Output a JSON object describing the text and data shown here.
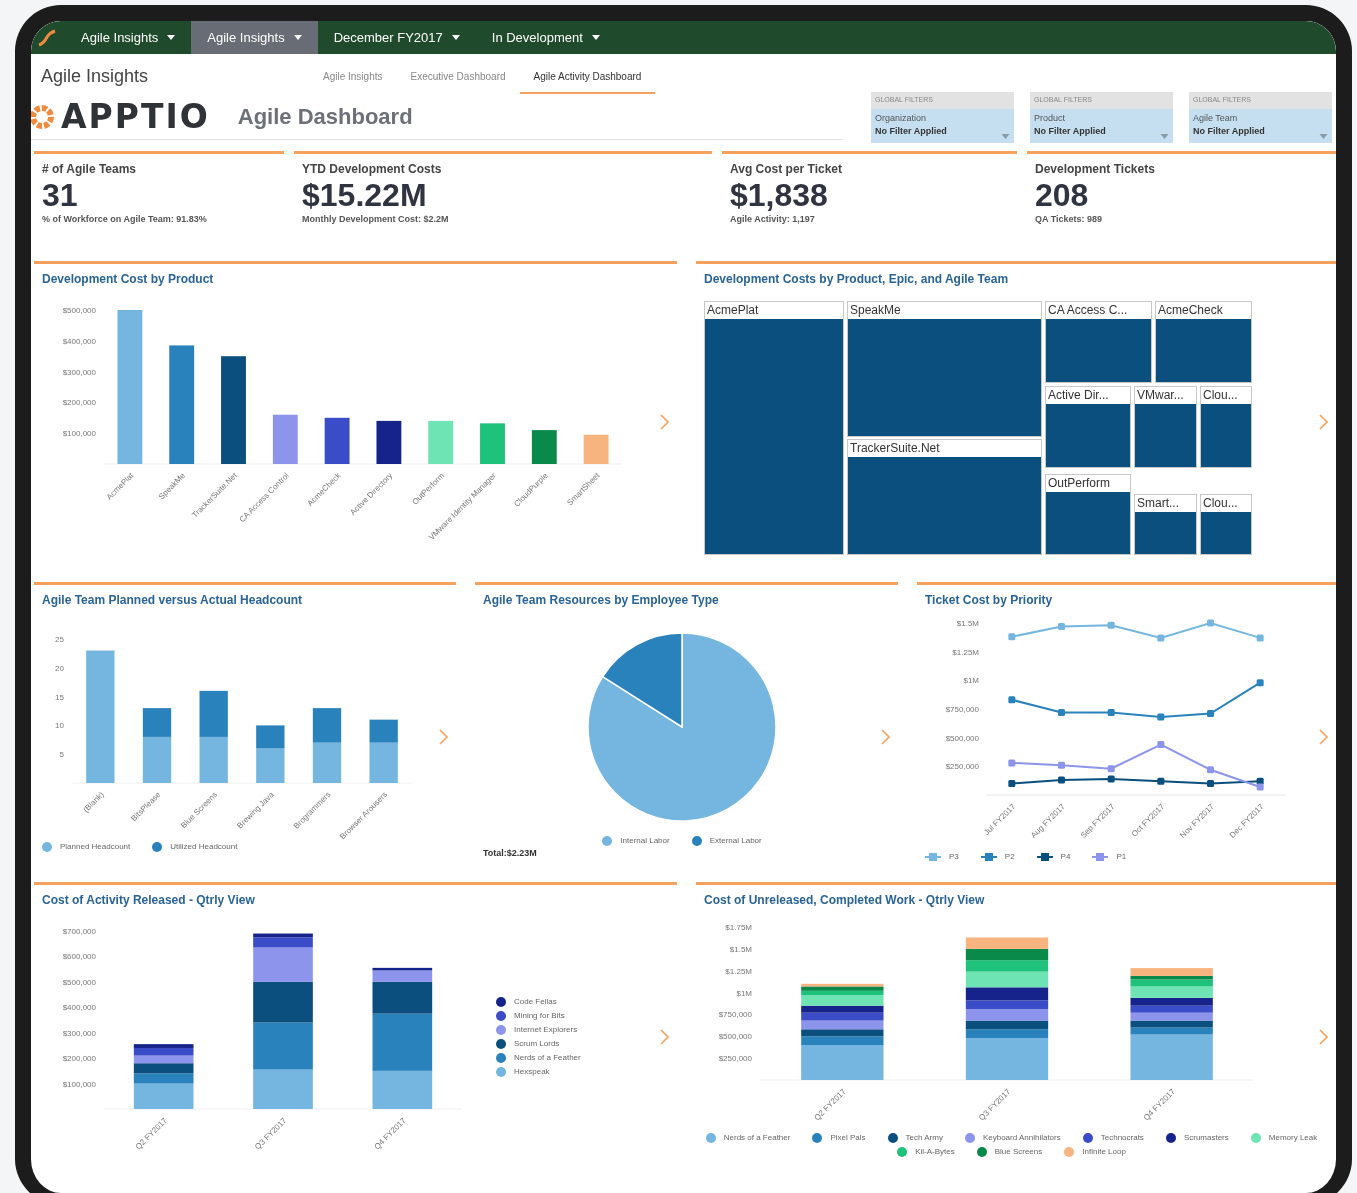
{
  "top_nav": [
    {
      "label": "Agile Insights",
      "selected": false
    },
    {
      "label": "Agile Insights",
      "selected": true
    },
    {
      "label": "December FY2017",
      "selected": false
    },
    {
      "label": "In Development",
      "selected": false
    }
  ],
  "header": {
    "app_title": "Agile Insights",
    "tabs": [
      {
        "label": "Agile Insights",
        "selected": false
      },
      {
        "label": "Executive Dashboard",
        "selected": false
      },
      {
        "label": "Agile Activity Dashboard",
        "selected": true
      }
    ],
    "brand": "APPTIO",
    "dashboard_title": "Agile Dashboard",
    "filters": [
      {
        "group": "GLOBAL FILTERS",
        "label": "Organization",
        "value": "No Filter Applied"
      },
      {
        "group": "GLOBAL FILTERS",
        "label": "Product",
        "value": "No Filter Applied"
      },
      {
        "group": "GLOBAL FILTERS",
        "label": "Agile Team",
        "value": "No Filter Applied"
      }
    ]
  },
  "kpis": [
    {
      "title": "# of Agile Teams",
      "value": "31",
      "note": "% of Workforce on Agile Team: 91.83%"
    },
    {
      "title": "YTD Development Costs",
      "value": "$15.22M",
      "note": "Monthly Development Cost: $2.2M"
    },
    {
      "title": "Avg Cost per Ticket",
      "value": "$1,838",
      "note": "Agile Activity: 1,197"
    },
    {
      "title": "Development Tickets",
      "value": "208",
      "note": "QA Tickets: 989"
    }
  ],
  "panels": [
    {
      "kind": "chart",
      "title": "Development Cost by Product",
      "chart_data": {
        "type": "bar",
        "categories": [
          "AcmePlat",
          "SpeakMe",
          "TrackerSuite.Net",
          "CA Access Control",
          "AcmeCheck",
          "Active Directory",
          "OutPerform",
          "VMware Identity Manager",
          "CloudPurple",
          "SmartSheet"
        ],
        "series": [
          {
            "values": [
              500000,
              385000,
              350000,
              160000,
              150000,
              140000,
              140000,
              132000,
              110000,
              95000
            ]
          }
        ],
        "colors": [
          "#74b6e0",
          "#2a82bd",
          "#0a4f7e",
          "#8c94ec",
          "#3b4cc8",
          "#15238a",
          "#6ee3b4",
          "#1ec27a",
          "#0a8a4a",
          "#f8b47e"
        ],
        "ylim": [
          0,
          500000
        ],
        "yticks": [
          {
            "value": 100000,
            "label": "$100,000"
          },
          {
            "value": 200000,
            "label": "$200,000"
          },
          {
            "value": 300000,
            "label": "$300,000"
          },
          {
            "value": 400000,
            "label": "$400,000"
          },
          {
            "value": 500000,
            "label": "$500,000"
          }
        ]
      }
    },
    {
      "kind": "treemap",
      "title": "Development Costs by Product, Epic, and Agile Team",
      "tiles": [
        {
          "label": "AcmePlat"
        },
        {
          "label": "SpeakMe"
        },
        {
          "label": "TrackerSuite.Net"
        },
        {
          "label": "CA Access C..."
        },
        {
          "label": "AcmeCheck"
        },
        {
          "label": "Active Dir..."
        },
        {
          "label": "VMwar..."
        },
        {
          "label": "Clou..."
        },
        {
          "label": "OutPerform"
        },
        {
          "label": "Smart..."
        },
        {
          "label": "Clou..."
        }
      ]
    },
    {
      "kind": "chart",
      "title": "Agile Team Planned versus Actual Headcount",
      "chart_data": {
        "type": "bar",
        "stacked": true,
        "legend": true,
        "categories": [
          "(Blank)",
          "BitsPlease",
          "Blue Screens",
          "Brewing Java",
          "Brogrammers",
          "Browser Arousers"
        ],
        "series": [
          {
            "name": "Planned Headcount",
            "color": "#74b6e0",
            "values": [
              23,
              8,
              8,
              6,
              7,
              7
            ]
          },
          {
            "name": "Utilized Headcount",
            "color": "#2a82bd",
            "values": [
              null,
              5,
              8,
              4,
              6,
              4
            ]
          }
        ],
        "ylim": [
          0,
          25
        ],
        "yticks": [
          5,
          10,
          15,
          20,
          25
        ]
      }
    },
    {
      "kind": "chart",
      "title": "Agile Team Resources by Employee Type",
      "total": "Total:$2.23M",
      "chart_data": {
        "type": "pie",
        "legend": true,
        "categories": [
          "Internal Labor",
          "External Labor"
        ],
        "values": [
          84,
          16
        ],
        "colors": [
          "#74b6e0",
          "#2a82bd"
        ]
      }
    },
    {
      "kind": "chart",
      "title": "Ticket Cost by Priority",
      "chart_data": {
        "type": "line",
        "legend": true,
        "x": [
          "Jul FY2017",
          "Aug FY2017",
          "Sep FY2017",
          "Oct FY2017",
          "Nov FY2017",
          "Dec FY2017"
        ],
        "series": [
          {
            "name": "P3",
            "color": "#74b6e0",
            "marker": "square",
            "values": [
              1380000,
              1470000,
              1480000,
              1370000,
              1500000,
              1370000
            ]
          },
          {
            "name": "P2",
            "color": "#2a82bd",
            "marker": "square",
            "values": [
              830000,
              720000,
              720000,
              680000,
              710000,
              980000
            ]
          },
          {
            "name": "P4",
            "color": "#0a4f7e",
            "marker": "square",
            "values": [
              100000,
              130000,
              140000,
              120000,
              100000,
              120000
            ]
          },
          {
            "name": "P1",
            "color": "#8c94ec",
            "marker": "square",
            "values": [
              280000,
              260000,
              230000,
              440000,
              220000,
              70000
            ]
          }
        ],
        "ylim": [
          0,
          1500000
        ],
        "yticks": [
          {
            "value": 250000,
            "label": "$250,000"
          },
          {
            "value": 500000,
            "label": "$500,000"
          },
          {
            "value": 750000,
            "label": "$750,000"
          },
          {
            "value": 1000000,
            "label": "$1M"
          },
          {
            "value": 1250000,
            "label": "$1.25M"
          },
          {
            "value": 1500000,
            "label": "$1.5M"
          }
        ]
      }
    },
    {
      "kind": "chart",
      "title": "Cost of Activity Released - Qtrly View",
      "chart_data": {
        "type": "bar",
        "stacked": true,
        "legend": true,
        "categories": [
          "Q2 FY2017",
          "Q3 FY2017",
          "Q4 FY2017"
        ],
        "series": [
          {
            "name": "Hexspeak",
            "color": "#74b6e0",
            "values": [
              100000,
              155000,
              150000
            ]
          },
          {
            "name": "Nerds of a Feather",
            "color": "#2a82bd",
            "values": [
              40000,
              185000,
              225000
            ]
          },
          {
            "name": "Scrum Lords",
            "color": "#0a4f7e",
            "values": [
              40000,
              160000,
              125000
            ]
          },
          {
            "name": "Internet Explorers",
            "color": "#8c94ec",
            "values": [
              30000,
              135000,
              45000
            ]
          },
          {
            "name": "Mining for Bits",
            "color": "#3b4cc8",
            "values": [
              30000,
              40000,
              null
            ]
          },
          {
            "name": "Code Fellas",
            "color": "#15238a",
            "values": [
              15000,
              15000,
              10000
            ]
          }
        ],
        "ylim": [
          0,
          700000
        ],
        "yticks": [
          {
            "value": 100000,
            "label": "$100,000"
          },
          {
            "value": 200000,
            "label": "$200,000"
          },
          {
            "value": 300000,
            "label": "$300,000"
          },
          {
            "value": 400000,
            "label": "$400,000"
          },
          {
            "value": 500000,
            "label": "$500,000"
          },
          {
            "value": 600000,
            "label": "$600,000"
          },
          {
            "value": 700000,
            "label": "$700,000"
          }
        ]
      }
    },
    {
      "kind": "chart",
      "title": "Cost of Unreleased, Completed Work - Qtrly View",
      "chart_data": {
        "type": "bar",
        "stacked": true,
        "legend": true,
        "categories": [
          "Q2 FY2017",
          "Q3 FY2017",
          "Q4 FY2017"
        ],
        "series": [
          {
            "name": "Nerds of a Feather",
            "color": "#74b6e0",
            "values": [
              400000,
              480000,
              520000
            ]
          },
          {
            "name": "Pixel Pals",
            "color": "#2a82bd",
            "values": [
              100000,
              100000,
              80000
            ]
          },
          {
            "name": "Tech Army",
            "color": "#0a4f7e",
            "values": [
              80000,
              100000,
              80000
            ]
          },
          {
            "name": "Keyboard Annihilators",
            "color": "#8c94ec",
            "values": [
              100000,
              130000,
              90000
            ]
          },
          {
            "name": "Technocrats",
            "color": "#3b4cc8",
            "values": [
              90000,
              100000,
              80000
            ]
          },
          {
            "name": "Scrumasters",
            "color": "#15238a",
            "values": [
              80000,
              150000,
              90000
            ]
          },
          {
            "name": "Memory Leak",
            "color": "#6ee3b4",
            "values": [
              120000,
              180000,
              130000
            ]
          },
          {
            "name": "Kil-A-Bytes",
            "color": "#1ec27a",
            "values": [
              50000,
              130000,
              80000
            ]
          },
          {
            "name": "Blue Screens",
            "color": "#0a8a4a",
            "values": [
              50000,
              130000,
              40000
            ]
          },
          {
            "name": "Infinite Loop",
            "color": "#f8b47e",
            "values": [
              30000,
              130000,
              90000
            ]
          }
        ],
        "ylim": [
          0,
          1750000
        ],
        "yticks": [
          {
            "value": 250000,
            "label": "$250,000"
          },
          {
            "value": 500000,
            "label": "$500,000"
          },
          {
            "value": 750000,
            "label": "$750,000"
          },
          {
            "value": 1000000,
            "label": "$1M"
          },
          {
            "value": 1250000,
            "label": "$1.25M"
          },
          {
            "value": 1500000,
            "label": "$1.5M"
          },
          {
            "value": 1750000,
            "label": "$1.75M"
          }
        ]
      }
    }
  ]
}
